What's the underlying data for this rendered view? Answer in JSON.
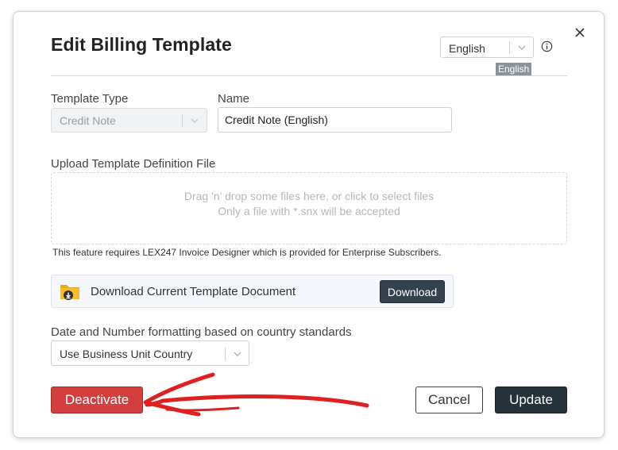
{
  "dialog": {
    "title": "Edit Billing Template",
    "language_select": {
      "value": "English"
    },
    "language_tag": "English"
  },
  "form": {
    "template_type": {
      "label": "Template Type",
      "value": "Credit Note"
    },
    "name": {
      "label": "Name",
      "value": "Credit Note (English)"
    },
    "upload": {
      "label": "Upload Template Definition File",
      "dropzone_line1": "Drag 'n' drop some files here, or click to select files",
      "dropzone_line2": "Only a file with *.snx will be accepted",
      "note": "This feature requires LEX247 Invoice Designer which is provided for Enterprise Subscribers."
    },
    "download": {
      "label": "Download Current Template Document",
      "button": "Download"
    },
    "formatting": {
      "label": "Date and Number formatting based on country standards",
      "value": "Use Business Unit Country"
    }
  },
  "footer": {
    "deactivate": "Deactivate",
    "cancel": "Cancel",
    "update": "Update"
  },
  "colors": {
    "danger": "#d33f3f",
    "primary_dark": "#26323a",
    "annotation_arrow": "#e02020"
  },
  "icons": [
    "close-icon",
    "chevron-down-icon",
    "info-icon",
    "folder-download-icon"
  ]
}
